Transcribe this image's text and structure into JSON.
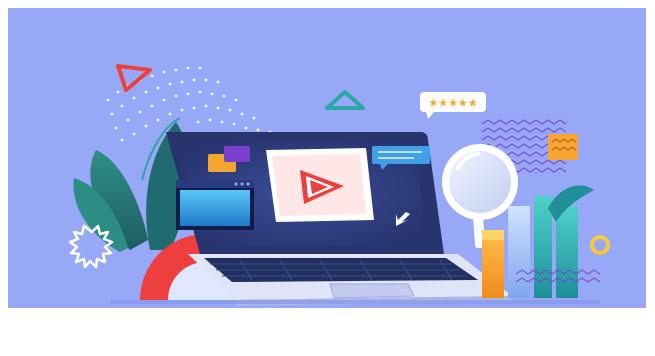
{
  "illustration": {
    "rating_bubble": {
      "stars": "★★★★★",
      "star_count": 5
    },
    "colors": {
      "background": "#97a8f7",
      "accent_red": "#ee3f3f",
      "accent_orange": "#f7a531",
      "accent_teal": "#2aa6a5",
      "accent_yellow": "#f8c93a",
      "laptop_dark": "#27346e"
    },
    "icons": [
      "triangle-outline-icon",
      "play-icon",
      "cursor-arrow-icon",
      "magnifying-glass-icon",
      "ring-icon",
      "star-icon"
    ]
  }
}
